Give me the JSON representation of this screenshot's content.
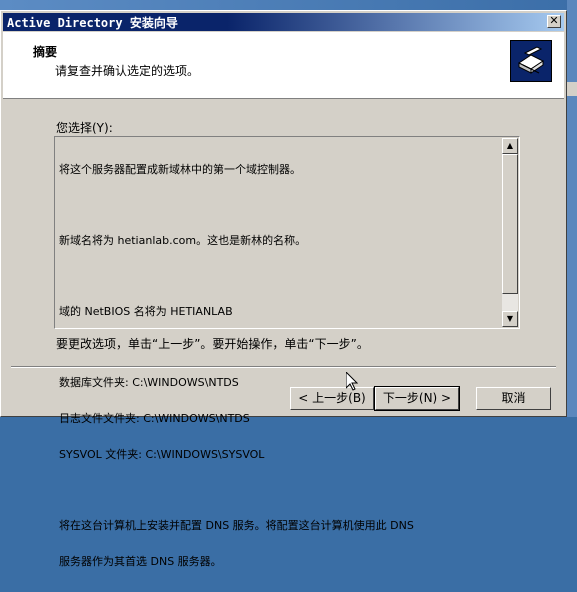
{
  "window": {
    "title": "Active Directory 安装向导",
    "close_label": "✕"
  },
  "header": {
    "title": "摘要",
    "subtitle": "请复查并确认选定的选项。",
    "icon": "wizard-book-icon"
  },
  "summary": {
    "label": "您选择(Y):",
    "lines": [
      "将这个服务器配置成新域林中的第一个域控制器。",
      "",
      "新域名将为 hetianlab.com。这也是新林的名称。",
      "",
      "域的 NetBIOS 名将为 HETIANLAB",
      "",
      "数据库文件夹: C:\\WINDOWS\\NTDS",
      "日志文件文件夹: C:\\WINDOWS\\NTDS",
      "SYSVOL 文件夹: C:\\WINDOWS\\SYSVOL",
      "",
      "将在这台计算机上安装并配置 DNS 服务。将配置这台计算机使用此 DNS",
      "服务器作为其首选 DNS 服务器。"
    ]
  },
  "hint": "要更改选项，单击“上一步”。要开始操作，单击“下一步”。",
  "buttons": {
    "back": "< 上一步(B)",
    "next": "下一步(N) >",
    "cancel": "取消"
  },
  "colors": {
    "titlebar_start": "#0a246a",
    "titlebar_end": "#a6caf0",
    "dialog_bg": "#d4d0c8",
    "desktop": "#3a6ea5"
  }
}
